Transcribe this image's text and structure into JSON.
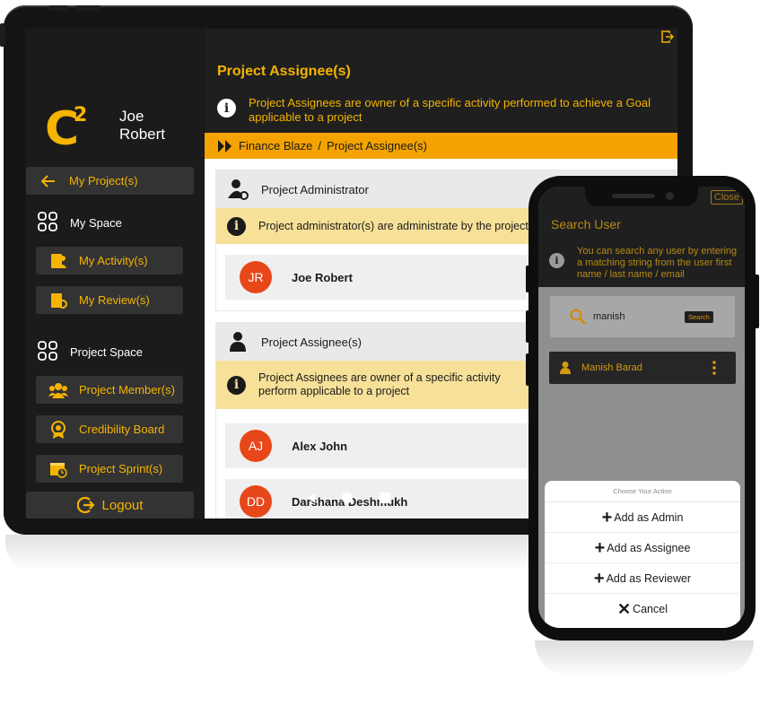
{
  "app": {
    "logo": "C",
    "logo_sup": "2"
  },
  "user": {
    "first": "Joe",
    "last": "Robert"
  },
  "sidebar": {
    "back_label": "My Project(s)",
    "my_space": {
      "heading": "My Space",
      "items": [
        "My Activity(s)",
        "My Review(s)"
      ]
    },
    "project_space": {
      "heading": "Project Space",
      "items": [
        "Project Member(s)",
        "Credibility Board",
        "Project Sprint(s)"
      ]
    },
    "logout_label": "Logout"
  },
  "main": {
    "title": "Project Assignee(s)",
    "description": "Project Assignees are owner of a specific activity performed to achieve a Goal applicable to a project",
    "breadcrumb": {
      "project": "Finance Blaze",
      "separator": "/",
      "page": "Project Assignee(s)"
    },
    "admin_section": {
      "title": "Project Administrator",
      "info": "Project administrator(s) are administrate by the project",
      "members": [
        {
          "initials": "JR",
          "name": "Joe Robert"
        }
      ]
    },
    "assignee_section": {
      "title": "Project Assignee(s)",
      "info": "Project Assignees are owner of a specific activity perform applicable to a project",
      "members": [
        {
          "initials": "AJ",
          "name": "Alex John"
        },
        {
          "initials": "DD",
          "name": "Darshana Deshmukh"
        }
      ]
    }
  },
  "phone": {
    "close_label": "Close",
    "title": "Search User",
    "description": "You can search any user by entering a matching string from the user first name / last name / email",
    "search_value": "manish",
    "search_button": "Search",
    "result_name": "Manish Barad",
    "action_sheet": {
      "title": "Choose Your Action",
      "actions": [
        "Add as Admin",
        "Add as Assignee",
        "Add as Reviewer",
        "Cancel"
      ]
    }
  },
  "colors": {
    "accent": "#f5b400",
    "dark": "#1f1f1f",
    "avatar": "#e8471a",
    "info_bg": "#f7e199",
    "breadcrumb_bg": "#f5a300"
  }
}
